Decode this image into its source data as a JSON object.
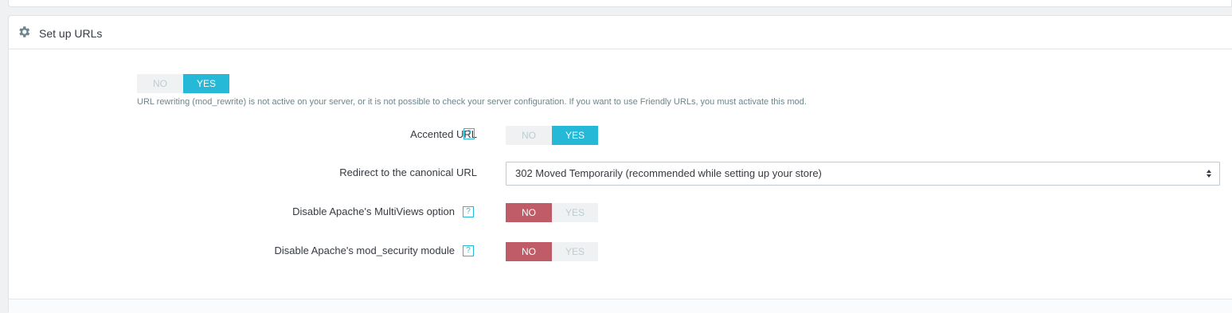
{
  "panel": {
    "title": "Set up URLs",
    "icon": "gear-icon"
  },
  "friendly_url": {
    "no_label": "NO",
    "yes_label": "YES",
    "selected": "YES",
    "help": "URL rewriting (mod_rewrite) is not active on your server, or it is not possible to check your server configuration. If you want to use Friendly URLs, you must activate this mod."
  },
  "accented_url": {
    "label": "Accented URL",
    "help_icon": "?",
    "no_label": "NO",
    "yes_label": "YES",
    "selected": "YES"
  },
  "canonical_redirect": {
    "label": "Redirect to the canonical URL",
    "value": "302 Moved Temporarily (recommended while setting up your store)"
  },
  "multiviews": {
    "label": "Disable Apache's MultiViews option",
    "help_icon": "?",
    "no_label": "NO",
    "yes_label": "YES",
    "selected": "NO"
  },
  "mod_security": {
    "label": "Disable Apache's mod_security module",
    "help_icon": "?",
    "no_label": "NO",
    "yes_label": "YES",
    "selected": "NO"
  },
  "colors": {
    "accent": "#25b9d7",
    "danger": "#c05c67"
  }
}
